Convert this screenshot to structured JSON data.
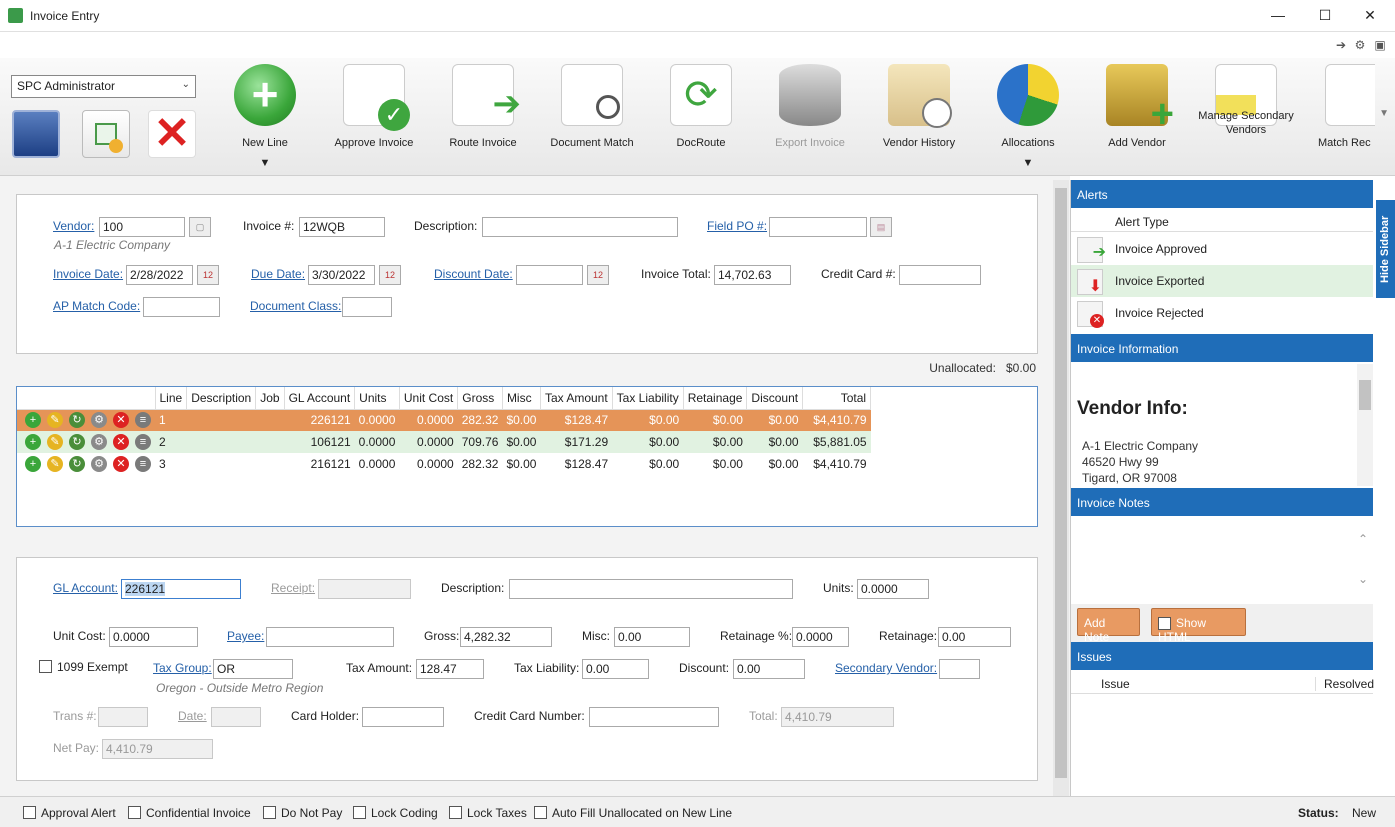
{
  "window": {
    "title": "Invoice Entry"
  },
  "user_select": "SPC Administrator",
  "ribbon": [
    {
      "id": "new-line",
      "label": "New Line",
      "arrow": true
    },
    {
      "id": "approve-invoice",
      "label": "Approve Invoice"
    },
    {
      "id": "route-invoice",
      "label": "Route Invoice"
    },
    {
      "id": "document-match",
      "label": "Document Match"
    },
    {
      "id": "docroute",
      "label": "DocRoute"
    },
    {
      "id": "export-invoice",
      "label": "Export Invoice",
      "disabled": true
    },
    {
      "id": "vendor-history",
      "label": "Vendor History"
    },
    {
      "id": "allocations",
      "label": "Allocations",
      "arrow": true
    },
    {
      "id": "add-vendor",
      "label": "Add Vendor"
    },
    {
      "id": "manage-secondary-vendors",
      "label": "Manage Secondary Vendors"
    },
    {
      "id": "match-receipts",
      "label": "Match Rec"
    }
  ],
  "header": {
    "vendor_label": "Vendor:",
    "vendor": "100",
    "vendor_name": "A-1 Electric Company",
    "invoice_no_label": "Invoice #:",
    "invoice_no": "12WQB",
    "description_label": "Description:",
    "description": "",
    "field_po_label": "Field PO #:",
    "field_po": "",
    "invoice_date_label": "Invoice Date:",
    "invoice_date": "2/28/2022",
    "due_date_label": "Due Date:",
    "due_date": "3/30/2022",
    "discount_date_label": "Discount Date:",
    "discount_date": "",
    "invoice_total_label": "Invoice Total:",
    "invoice_total": "14,702.63",
    "credit_card_label": "Credit Card #:",
    "credit_card": "",
    "ap_match_label": "AP Match Code:",
    "ap_match": "",
    "doc_class_label": "Document Class:",
    "doc_class": ""
  },
  "unallocated": {
    "label": "Unallocated:",
    "value": "$0.00"
  },
  "grid": {
    "columns": [
      "Line",
      "Description",
      "Job",
      "GL Account",
      "Units",
      "Unit Cost",
      "Gross",
      "Misc",
      "Tax Amount",
      "Tax Liability",
      "Retainage",
      "Discount",
      "Total"
    ],
    "rows": [
      [
        "1",
        "",
        "",
        "226121",
        "0.0000",
        "0.0000",
        "282.32",
        "$0.00",
        "$128.47",
        "$0.00",
        "$0.00",
        "$0.00",
        "$4,410.79"
      ],
      [
        "2",
        "",
        "",
        "106121",
        "0.0000",
        "0.0000",
        "709.76",
        "$0.00",
        "$171.29",
        "$0.00",
        "$0.00",
        "$0.00",
        "$5,881.05"
      ],
      [
        "3",
        "",
        "",
        "216121",
        "0.0000",
        "0.0000",
        "282.32",
        "$0.00",
        "$128.47",
        "$0.00",
        "$0.00",
        "$0.00",
        "$4,410.79"
      ]
    ]
  },
  "detail": {
    "gl_account_label": "GL Account:",
    "gl_account": "226121",
    "receipt_label": "Receipt:",
    "receipt": "",
    "description_label": "Description:",
    "description": "",
    "units_label": "Units:",
    "units": "0.0000",
    "unit_cost_label": "Unit Cost:",
    "unit_cost": "0.0000",
    "payee_label": "Payee:",
    "payee": "",
    "gross_label": "Gross:",
    "gross": "4,282.32",
    "misc_label": "Misc:",
    "misc": "0.00",
    "retainage_pct_label": "Retainage %:",
    "retainage_pct": "0.0000",
    "retainage_label": "Retainage:",
    "retainage": "0.00",
    "exempt_label": "1099 Exempt",
    "tax_group_label": "Tax Group:",
    "tax_group": "OR",
    "tax_group_name": "Oregon - Outside Metro Region",
    "tax_amount_label": "Tax Amount:",
    "tax_amount": "128.47",
    "tax_liability_label": "Tax Liability:",
    "tax_liability": "0.00",
    "discount_label": "Discount:",
    "discount": "0.00",
    "secondary_vendor_label": "Secondary Vendor:",
    "secondary_vendor": "",
    "trans_label": "Trans #:",
    "trans": "",
    "date_label": "Date:",
    "date": "",
    "card_holder_label": "Card Holder:",
    "card_holder": "",
    "cc_number_label": "Credit Card Number:",
    "cc_number": "",
    "total_label": "Total:",
    "total": "4,410.79",
    "net_pay_label": "Net Pay:",
    "net_pay": "4,410.79"
  },
  "bottom": {
    "checks": [
      "Approval Alert",
      "Confidential Invoice",
      "Do Not Pay",
      "Lock Coding",
      "Lock Taxes",
      "Auto Fill Unallocated on New Line"
    ],
    "status_label": "Status:",
    "status": "New"
  },
  "sidebar": {
    "hide_label": "Hide Sidebar",
    "alerts_title": "Alerts",
    "alert_type_col": "Alert Type",
    "alerts": [
      "Invoice Approved",
      "Invoice Exported",
      "Invoice Rejected"
    ],
    "invoice_info_title": "Invoice Information",
    "vendor_info_heading": "Vendor Info:",
    "vendor_lines": [
      "A-1 Electric Company",
      "46520 Hwy 99",
      "Tigard, OR 97008"
    ],
    "notes_title": "Invoice Notes",
    "add_note": "Add Note",
    "show_html": "Show HTML",
    "issues_title": "Issues",
    "issue_col": "Issue",
    "resolved_col": "Resolved"
  },
  "colors": {
    "accent": "#1f6db8",
    "row_selected": "#e59458",
    "row_alt": "#e1f2e1",
    "button": "#e89a62"
  }
}
